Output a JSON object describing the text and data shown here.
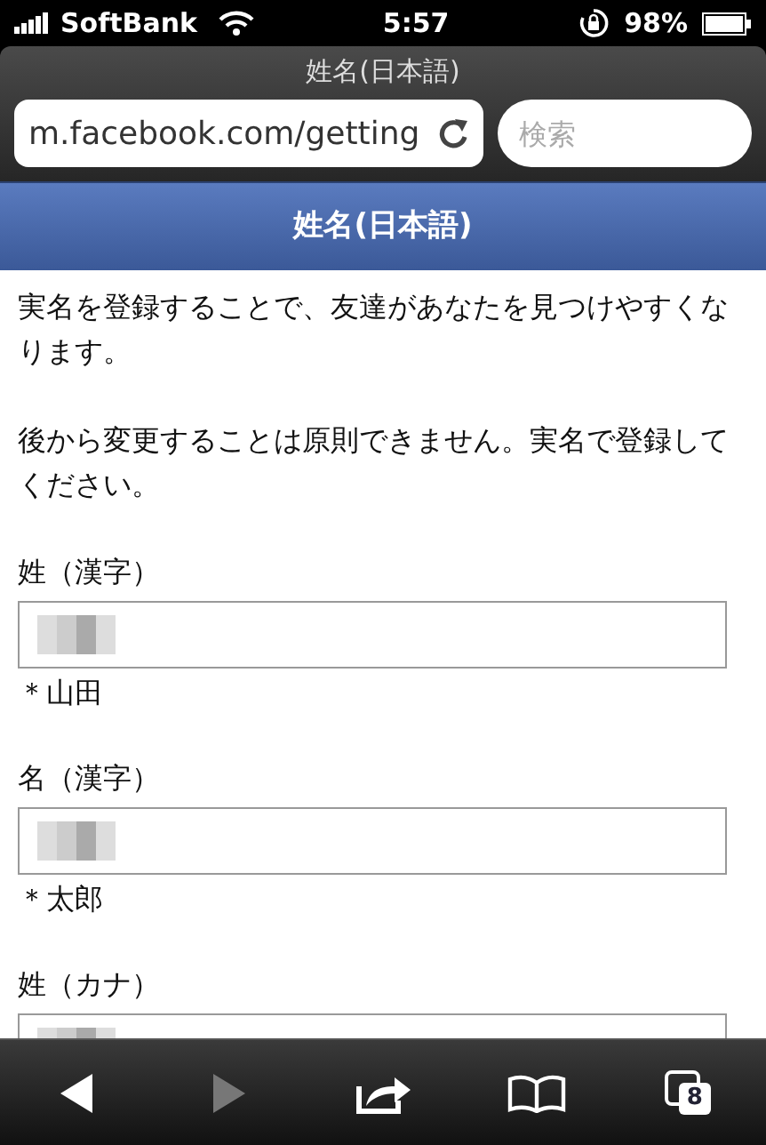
{
  "status_bar": {
    "carrier": "SoftBank",
    "time": "5:57",
    "battery": "98%"
  },
  "browser": {
    "title": "姓名(日本語)",
    "url": "m.facebook.com/getting",
    "search": {
      "placeholder": "検索"
    }
  },
  "page": {
    "header": "姓名(日本語)",
    "paragraphs": [
      "実名を登録することで、友達があなたを見つけやすくなります。",
      "後から変更することは原則できません。実名で登録してください。"
    ],
    "fields": [
      {
        "label": "姓（漢字）",
        "hint": "＊山田"
      },
      {
        "label": "名（漢字）",
        "hint": "＊太郎"
      },
      {
        "label": "姓（カナ）"
      }
    ]
  },
  "toolbar": [
    {
      "kind": "back",
      "disabled": false
    },
    {
      "kind": "forward",
      "disabled": true
    },
    {
      "kind": "share",
      "disabled": false
    },
    {
      "kind": "bookmarks",
      "disabled": false
    },
    {
      "kind": "tabs",
      "disabled": false,
      "count": "8"
    }
  ]
}
